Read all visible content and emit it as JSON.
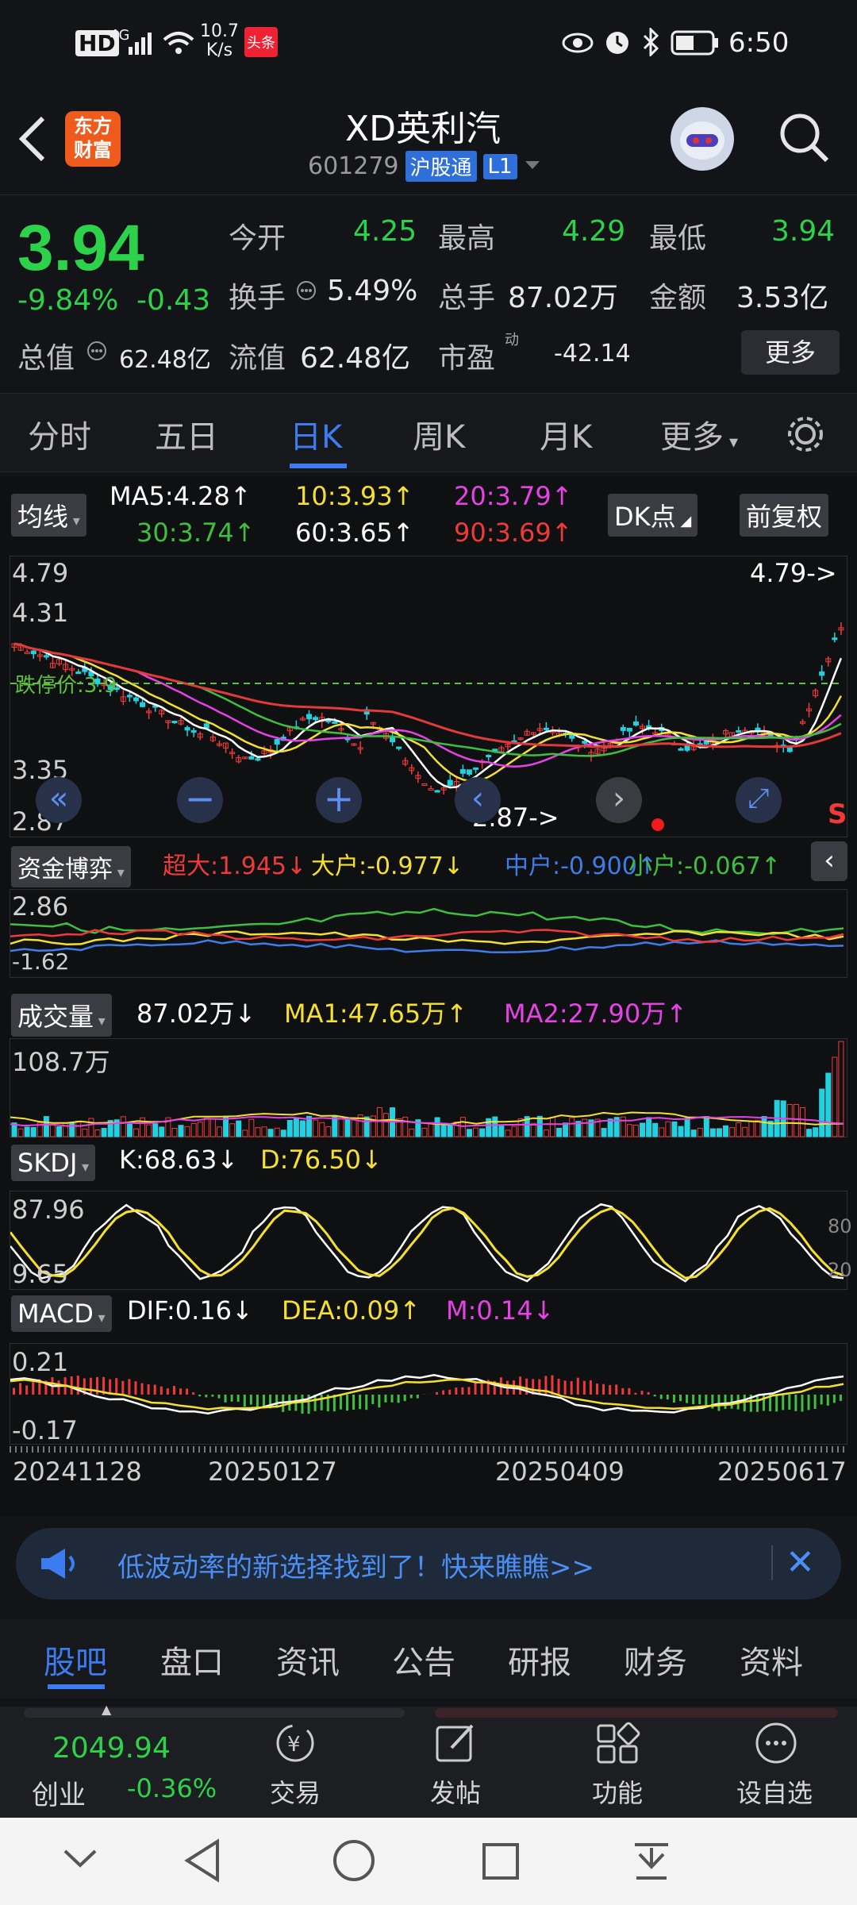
{
  "status": {
    "time": "6:50",
    "net_speed_top": "10.7",
    "net_speed_bottom": "K/s",
    "hd": "HD",
    "sig": "4G",
    "headline_badge": "头条"
  },
  "header": {
    "logo_top": "东方",
    "logo_bottom": "财富",
    "title": "XD英利汽",
    "code": "601279",
    "market": "沪股通",
    "level": "L1"
  },
  "quote": {
    "price": "3.94",
    "change_pct": "-9.84%",
    "change": "-0.43",
    "open_label": "今开",
    "open": "4.25",
    "high_label": "最高",
    "high": "4.29",
    "low_label": "最低",
    "low": "3.94",
    "turnover_label": "换手",
    "turnover": "5.49%",
    "volume_label": "总手",
    "volume": "87.02万",
    "amount_label": "金额",
    "amount": "3.53亿",
    "mktcap_label": "总值",
    "mktcap": "62.48亿",
    "float_label": "流值",
    "float": "62.48亿",
    "pe_label": "市盈",
    "pe_sup": "动",
    "pe": "-42.14",
    "more": "更多"
  },
  "tabs": [
    "分时",
    "五日",
    "日K",
    "周K",
    "月K",
    "更多"
  ],
  "kline": {
    "ma_button": "均线",
    "dk_button": "DK点",
    "adjust_button": "前复权",
    "ma5": "MA5:4.28",
    "ma10": "10:3.93",
    "ma20": "20:3.79",
    "ma30": "30:3.74",
    "ma60": "60:3.65",
    "ma90": "90:3.69",
    "y_top": "4.79",
    "y_2": "4.31",
    "y_3": "3.35",
    "y_bottom": "2.87",
    "cost_label": "跌停价:3.9",
    "max_marker": "4.79->",
    "min_marker": "2.87->",
    "s_marker": "S"
  },
  "fund": {
    "label": "资金博弈",
    "super": "超大:1.945",
    "big": "大户:-0.977",
    "mid": "中户:-0.900",
    "small": "小户:-0.067",
    "y_top": "2.86",
    "y_bottom": "-1.62"
  },
  "vol": {
    "label": "成交量",
    "value": "87.02万",
    "ma1": "MA1:47.65万",
    "ma2": "MA2:27.90万",
    "y_top": "108.7万"
  },
  "skdj": {
    "label": "SKDJ",
    "k": "K:68.63",
    "d": "D:76.50",
    "y_top": "87.96",
    "y_bottom": "9.65",
    "r80": "80",
    "r20": "20"
  },
  "macd": {
    "label": "MACD",
    "dif": "DIF:0.16",
    "dea": "DEA:0.09",
    "m": "M:0.14",
    "y_top": "0.21",
    "y_bottom": "-0.17"
  },
  "dates": [
    "20241128",
    "20250127",
    "20250409",
    "20250617"
  ],
  "banner": {
    "text": "低波动率的新选择找到了！快来瞧瞧>>"
  },
  "bottom_tabs": [
    "股吧",
    "盘口",
    "资讯",
    "公告",
    "研报",
    "财务",
    "资料"
  ],
  "footer": {
    "index_value": "2049.94",
    "index_name": "创业",
    "index_change": "-0.36%",
    "trade": "交易",
    "post": "发帖",
    "func": "功能",
    "watch": "设自选"
  }
}
